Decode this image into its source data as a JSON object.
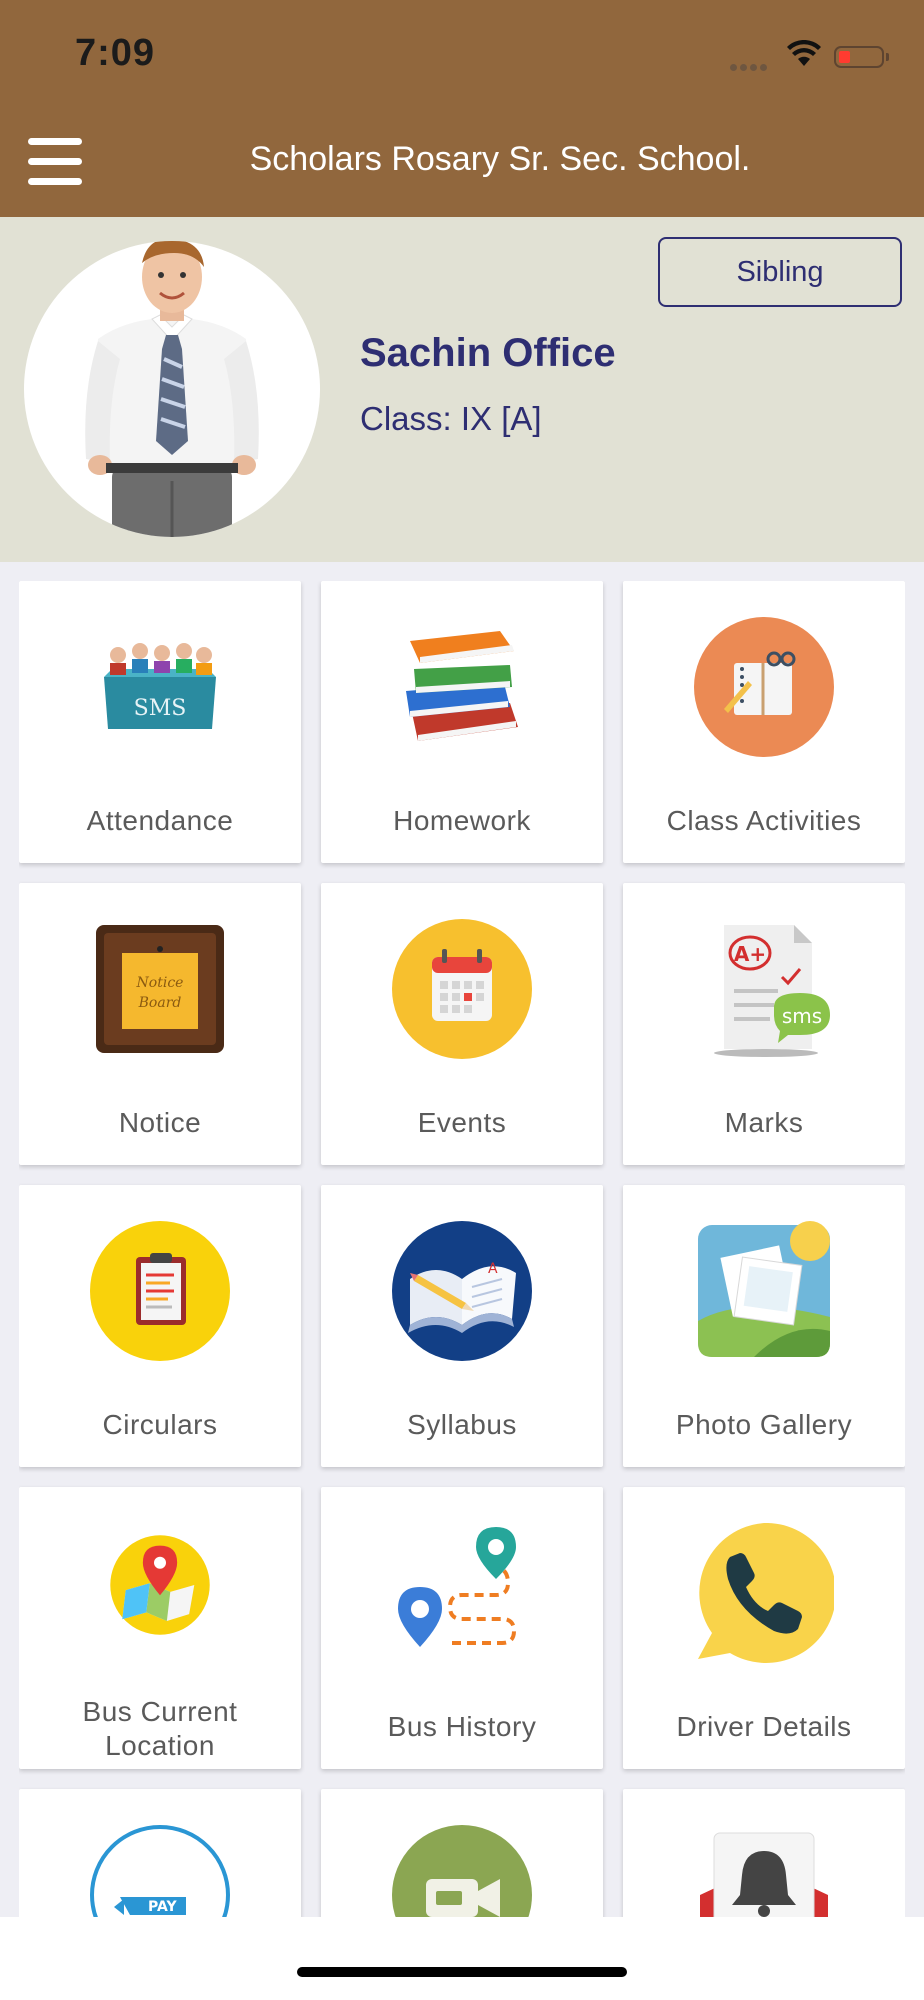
{
  "status_bar": {
    "time": "7:09"
  },
  "header": {
    "title": "Scholars Rosary Sr. Sec. School.",
    "menu_icon": "hamburger-menu-icon"
  },
  "profile": {
    "name": "Sachin Office",
    "class_label": "Class: IX [A]",
    "sibling_label": "Sibling"
  },
  "tiles": [
    {
      "label": "Attendance",
      "icon": "attendance-icon"
    },
    {
      "label": "Homework",
      "icon": "books-icon"
    },
    {
      "label": "Class Activities",
      "icon": "notebook-icon"
    },
    {
      "label": "Notice",
      "icon": "notice-board-icon"
    },
    {
      "label": "Events",
      "icon": "calendar-icon"
    },
    {
      "label": "Marks",
      "icon": "report-card-icon"
    },
    {
      "label": "Circulars",
      "icon": "clipboard-icon"
    },
    {
      "label": "Syllabus",
      "icon": "open-book-icon"
    },
    {
      "label": "Photo Gallery",
      "icon": "photos-icon"
    },
    {
      "label": "Bus Current Location",
      "icon": "map-pin-icon"
    },
    {
      "label": "Bus History",
      "icon": "route-icon"
    },
    {
      "label": "Driver Details",
      "icon": "phone-icon"
    },
    {
      "label": "",
      "icon": "pay-icon"
    },
    {
      "label": "",
      "icon": "video-icon"
    },
    {
      "label": "",
      "icon": "notification-bell-icon"
    }
  ],
  "colors": {
    "header": "#91673d",
    "profile_bg": "#e1e1d4",
    "accent_text": "#2e2e72",
    "page_bg": "#eeeef4"
  }
}
